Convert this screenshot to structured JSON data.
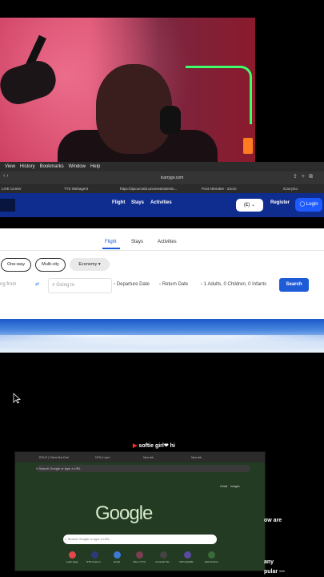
{
  "menubar": {
    "items": [
      "View",
      "History",
      "Bookmarks",
      "Window",
      "Help"
    ]
  },
  "safari": {
    "url": "icarrygo.com",
    "tabs": [
      {
        "label": "LIVE Center"
      },
      {
        "label": "TTS Webagent"
      },
      {
        "label": "https://ajsoumal3.azurewebsitesin..."
      },
      {
        "label": "Post Attendee - Zoom"
      },
      {
        "label": "iCarryGo"
      }
    ]
  },
  "site": {
    "nav": [
      "Flight",
      "Stays",
      "Activities"
    ],
    "currency": "(£)",
    "register": "Register",
    "login": "Login",
    "search_tabs": [
      "Flight",
      "Stays",
      "Activities"
    ],
    "trip_types": [
      "One-way",
      "Multi-city"
    ],
    "cabin": "Economy",
    "from_placeholder": "ng from",
    "to_placeholder": "Going to",
    "departure": "Departure Date",
    "return": "Return Date",
    "travellers": "1 Adults, 0 Children, 0 Infants",
    "search_button": "Search"
  },
  "caption": "softie girl❤ hi",
  "chrome": {
    "tabs": [
      "ROUC | Oders first Ded",
      "NTN & sya I",
      "New tab",
      "New tab"
    ],
    "omnibox": "Search Google or type a URL",
    "gmail": "Gmail",
    "images": "Images",
    "logo": "Google",
    "search_placeholder": "Search Google or type a URL",
    "shortcuts": [
      {
        "label": "Login page",
        "color": "#e2474a"
      },
      {
        "label": "NTN Custom...",
        "color": "#2d3a7a"
      },
      {
        "label": "Email",
        "color": "#3d7ad8"
      },
      {
        "label": "Inbox (TY3)",
        "color": "#7a3d52"
      },
      {
        "label": "Consular Me...",
        "color": "#444"
      },
      {
        "label": "CDN abetDE...",
        "color": "#5a4aa0"
      },
      {
        "label": "Add shortcut",
        "color": "#3a6b3a"
      }
    ]
  },
  "side_text": [
    "ow are",
    "any",
    "pular —"
  ]
}
